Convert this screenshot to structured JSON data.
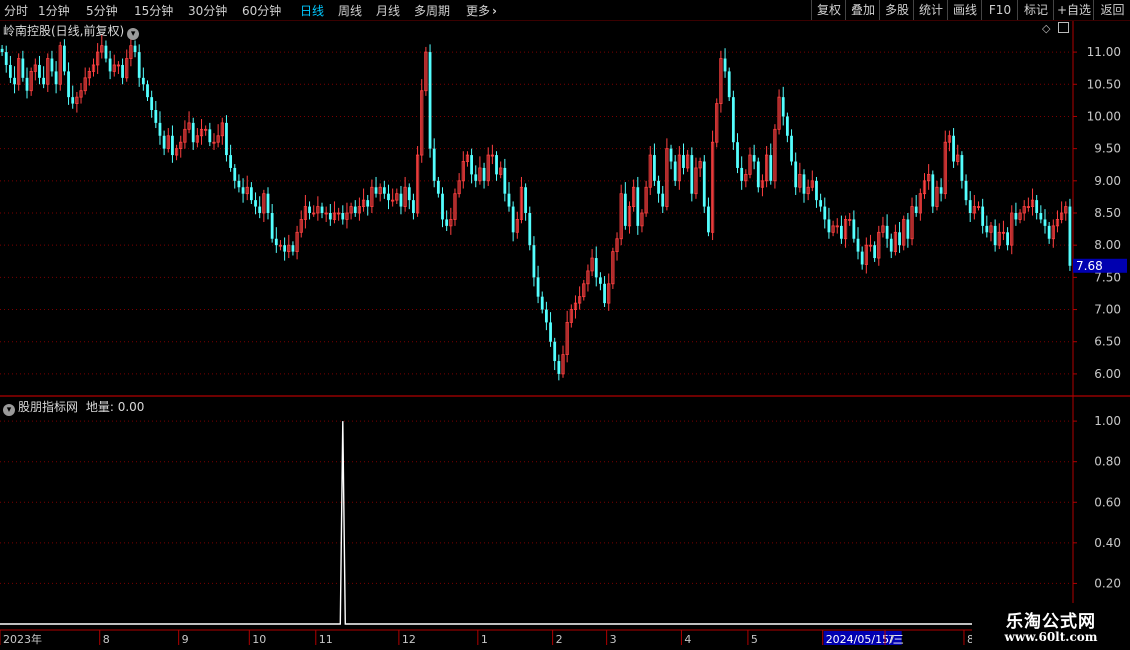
{
  "toolbar": {
    "periods": [
      "分时",
      "1分钟",
      "5分钟",
      "15分钟",
      "30分钟",
      "60分钟",
      "日线",
      "周线",
      "月线",
      "多周期",
      "更多"
    ],
    "active_period": "日线",
    "more_arrow": "›",
    "right_buttons": [
      "复权",
      "叠加",
      "多股",
      "统计",
      "画线",
      "F10",
      "标记",
      "+自选",
      "返回"
    ]
  },
  "main_panel": {
    "title": "岭南控股(日线,前复权)",
    "current_price_label": "7.68"
  },
  "indicator_panel": {
    "title": "股朋指标网",
    "field_label": "地量:",
    "field_value": "0.00"
  },
  "logo": {
    "text": "乐淘公式网",
    "url": "www.60lt.com"
  },
  "colors": {
    "up": "#ff4040",
    "down": "#54ffff",
    "grid": "#7a0000",
    "axis": "#b00000",
    "tick_text": "#c8c8c8",
    "price_tag_bg": "#0000b0",
    "date_tag_bg": "#0000b0",
    "indicator_line": "#ffffff"
  },
  "chart_data": [
    {
      "type": "candlestick",
      "title": "岭南控股(日线,前复权)",
      "ylim": [
        5.75,
        11.25
      ],
      "y_ticks": [
        "6.00",
        "6.50",
        "7.00",
        "7.50",
        "8.00",
        "8.50",
        "9.00",
        "9.50",
        "10.00",
        "10.50",
        "11.00"
      ],
      "x_labels": [
        "2023年",
        "8",
        "9",
        "10",
        "11",
        "12",
        "1",
        "2",
        "3",
        "4",
        "5",
        "2024/05/15/三",
        "7",
        "8"
      ],
      "x_label_index": [
        0,
        24,
        43,
        60,
        76,
        96,
        115,
        133,
        146,
        164,
        180,
        198,
        213,
        232
      ],
      "closes": [
        11.0,
        10.8,
        10.6,
        10.5,
        10.9,
        10.6,
        10.4,
        10.7,
        10.8,
        10.6,
        10.5,
        10.9,
        10.7,
        10.5,
        11.1,
        10.7,
        10.3,
        10.2,
        10.3,
        10.4,
        10.6,
        10.7,
        10.8,
        11.0,
        11.1,
        10.9,
        10.7,
        10.8,
        10.8,
        10.6,
        10.9,
        11.1,
        11.0,
        10.6,
        10.5,
        10.3,
        10.1,
        9.9,
        9.7,
        9.5,
        9.7,
        9.4,
        9.5,
        9.6,
        9.8,
        9.9,
        9.6,
        9.7,
        9.8,
        9.8,
        9.6,
        9.6,
        9.7,
        9.9,
        9.4,
        9.2,
        9.0,
        8.9,
        8.8,
        8.9,
        8.7,
        8.6,
        8.5,
        8.8,
        8.5,
        8.1,
        8.0,
        8.0,
        7.9,
        8.0,
        7.9,
        8.2,
        8.4,
        8.6,
        8.5,
        8.5,
        8.6,
        8.5,
        8.5,
        8.4,
        8.5,
        8.5,
        8.4,
        8.5,
        8.6,
        8.5,
        8.6,
        8.7,
        8.6,
        8.9,
        8.8,
        8.9,
        8.8,
        8.7,
        8.7,
        8.8,
        8.6,
        8.9,
        8.7,
        8.5,
        9.4,
        10.4,
        11.0,
        9.5,
        9.0,
        8.8,
        8.4,
        8.3,
        8.4,
        8.8,
        9.0,
        9.3,
        9.4,
        9.1,
        9.0,
        9.2,
        9.0,
        9.4,
        9.4,
        9.1,
        9.2,
        8.8,
        8.6,
        8.2,
        8.4,
        8.9,
        8.5,
        8.0,
        7.5,
        7.2,
        7.0,
        6.8,
        6.5,
        6.2,
        6.0,
        6.3,
        6.8,
        7.0,
        7.1,
        7.2,
        7.4,
        7.6,
        7.8,
        7.5,
        7.4,
        7.1,
        7.4,
        7.9,
        8.1,
        8.8,
        8.3,
        8.6,
        8.9,
        8.3,
        8.5,
        8.9,
        9.4,
        9.0,
        8.8,
        8.6,
        9.5,
        9.3,
        9.0,
        9.4,
        9.2,
        9.4,
        8.8,
        9.2,
        9.3,
        8.6,
        8.2,
        9.6,
        10.2,
        10.9,
        10.7,
        10.3,
        9.6,
        9.2,
        9.0,
        9.1,
        9.4,
        9.3,
        8.9,
        9.0,
        9.4,
        9.0,
        9.8,
        10.3,
        10.0,
        9.7,
        9.3,
        8.9,
        9.1,
        8.8,
        8.9,
        9.0,
        8.7,
        8.6,
        8.4,
        8.2,
        8.3,
        8.3,
        8.1,
        8.4,
        8.4,
        8.1,
        7.9,
        7.7,
        8.0,
        8.0,
        7.8,
        8.2,
        8.3,
        8.1,
        7.9,
        8.2,
        8.0,
        8.4,
        8.1,
        8.6,
        8.5,
        8.8,
        9.0,
        9.1,
        8.6,
        8.9,
        8.8,
        9.6,
        9.7,
        9.3,
        9.4,
        9.0,
        8.7,
        8.5,
        8.6,
        8.6,
        8.3,
        8.2,
        8.3,
        8.0,
        8.2,
        8.2,
        8.0,
        8.5,
        8.4,
        8.5,
        8.6,
        8.6,
        8.7,
        8.5,
        8.4,
        8.3,
        8.1,
        8.3,
        8.4,
        8.5,
        8.6,
        7.68
      ]
    },
    {
      "type": "line",
      "title": "股朋指标网",
      "series": [
        {
          "name": "地量",
          "spike_index": 82,
          "spike_value": 1.0,
          "baseline_value": 0.0
        }
      ],
      "ylim": [
        0.0,
        1.04
      ],
      "y_ticks": [
        "0.20",
        "0.40",
        "0.60",
        "0.80",
        "1.00"
      ]
    }
  ]
}
